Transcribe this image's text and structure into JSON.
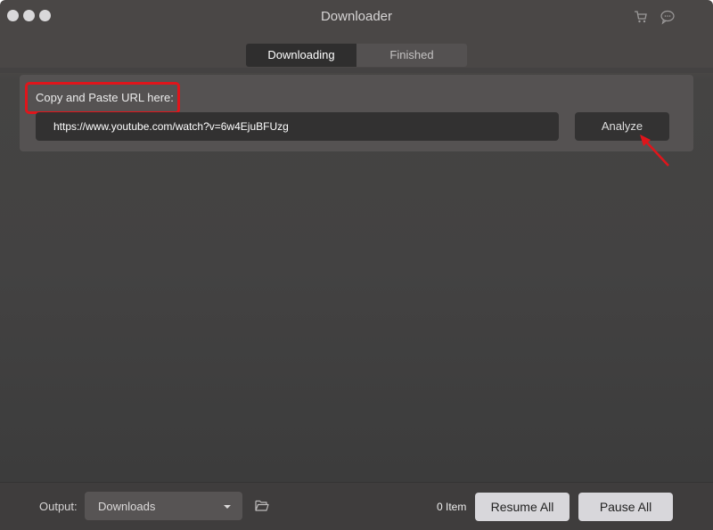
{
  "window": {
    "title": "Downloader",
    "traffic_lights": [
      "close",
      "minimize",
      "zoom"
    ],
    "header_icons": [
      {
        "name": "cart-icon",
        "label": "Store"
      },
      {
        "name": "chat-icon",
        "label": "Feedback"
      }
    ]
  },
  "tabs": [
    {
      "label": "Downloading",
      "active": true
    },
    {
      "label": "Finished",
      "active": false
    }
  ],
  "url_panel": {
    "label": "Copy and Paste URL here:",
    "url_value": "https://www.youtube.com/watch?v=6w4EjuBFUzg",
    "analyze_label": "Analyze",
    "annotation_color": "#e0151b"
  },
  "footer": {
    "output_label": "Output:",
    "output_selected": "Downloads",
    "item_count": "0 Item",
    "resume_all_label": "Resume All",
    "pause_all_label": "Pause All"
  },
  "colors": {
    "window_bg": "#4a4746",
    "panel_bg": "#555252",
    "input_bg": "#323131",
    "active_tab_bg": "#2f2e2e",
    "annotation_red": "#e0151b",
    "footer_button_bg": "#d8d7db"
  }
}
